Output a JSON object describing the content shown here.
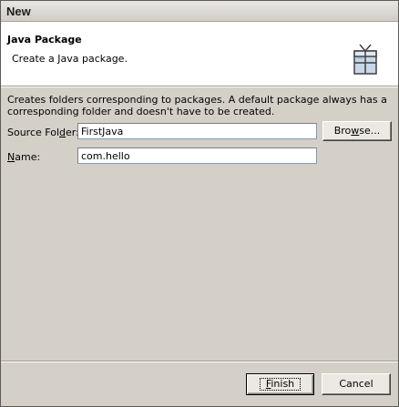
{
  "window": {
    "title": "New"
  },
  "banner": {
    "title": "Java Package",
    "description": "Create a Java package."
  },
  "info": {
    "text": "Creates folders corresponding to packages. A default package always has a corresponding folder and doesn't have to be created."
  },
  "form": {
    "source_folder": {
      "label_pre": "Source Fol",
      "label_mnemonic": "d",
      "label_post": "er:",
      "value": "FirstJava"
    },
    "name": {
      "label_mnemonic": "N",
      "label_post": "ame:",
      "value": "com.hello"
    }
  },
  "buttons": {
    "browse": {
      "label_pre": "Bro",
      "label_mnemonic": "w",
      "label_post": "se..."
    },
    "finish": {
      "label_mnemonic": "F",
      "label_post": "inish"
    },
    "cancel": {
      "label": "Cancel"
    }
  },
  "icons": {
    "banner": "java-package-icon"
  }
}
